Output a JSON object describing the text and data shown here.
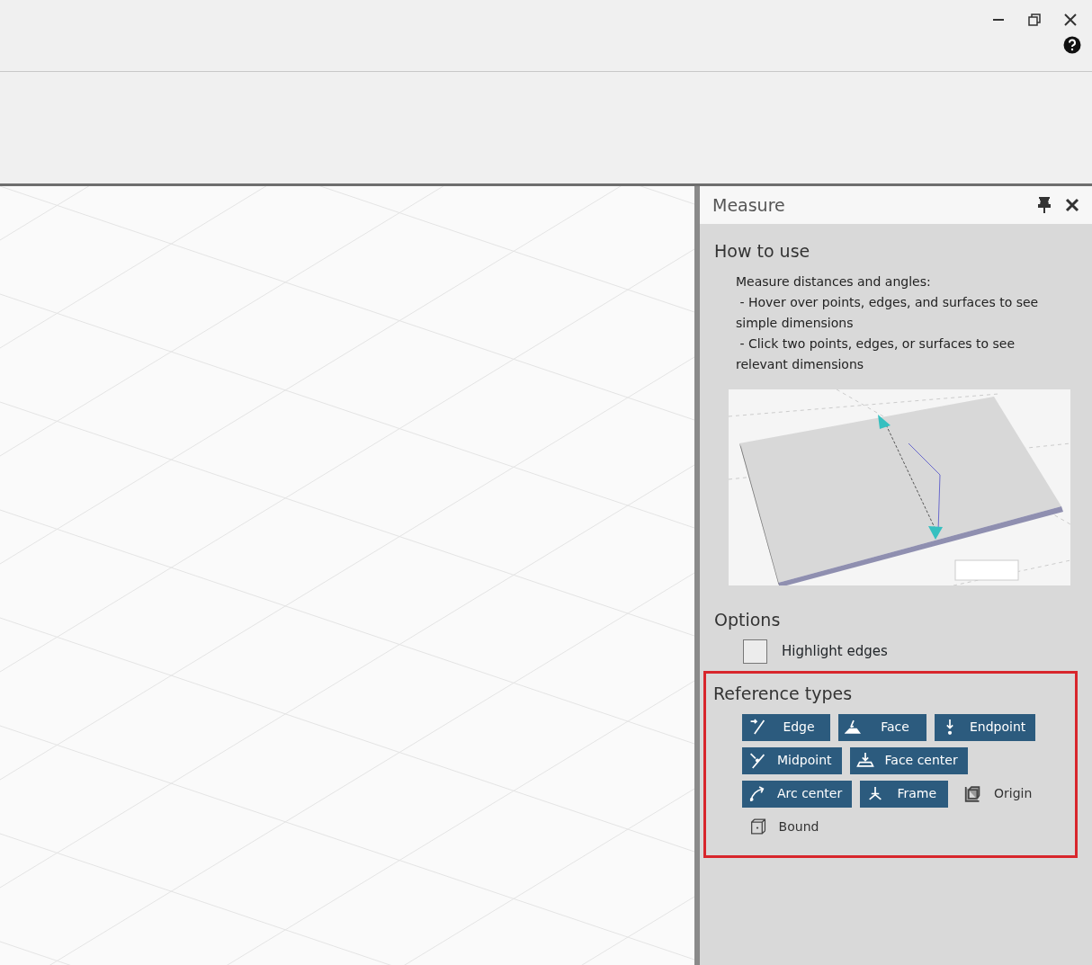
{
  "panel": {
    "title": "Measure",
    "how_to_use": {
      "heading": "How to use",
      "lines": [
        "Measure distances and angles:",
        " - Hover over points, edges, and surfaces to see simple dimensions",
        " - Click two points, edges, or surfaces to see relevant dimensions"
      ]
    },
    "options": {
      "heading": "Options",
      "items": [
        {
          "label": "Highlight edges",
          "checked": false
        }
      ]
    },
    "reference_types": {
      "heading": "Reference types",
      "highlighted": true,
      "items": [
        {
          "label": "Edge",
          "selected": true
        },
        {
          "label": "Face",
          "selected": true
        },
        {
          "label": "Endpoint",
          "selected": true
        },
        {
          "label": "Midpoint",
          "selected": true
        },
        {
          "label": "Face center",
          "selected": true
        },
        {
          "label": "Arc center",
          "selected": true
        },
        {
          "label": "Frame",
          "selected": true
        },
        {
          "label": "Origin",
          "selected": false
        },
        {
          "label": "Bound",
          "selected": false
        }
      ]
    }
  }
}
